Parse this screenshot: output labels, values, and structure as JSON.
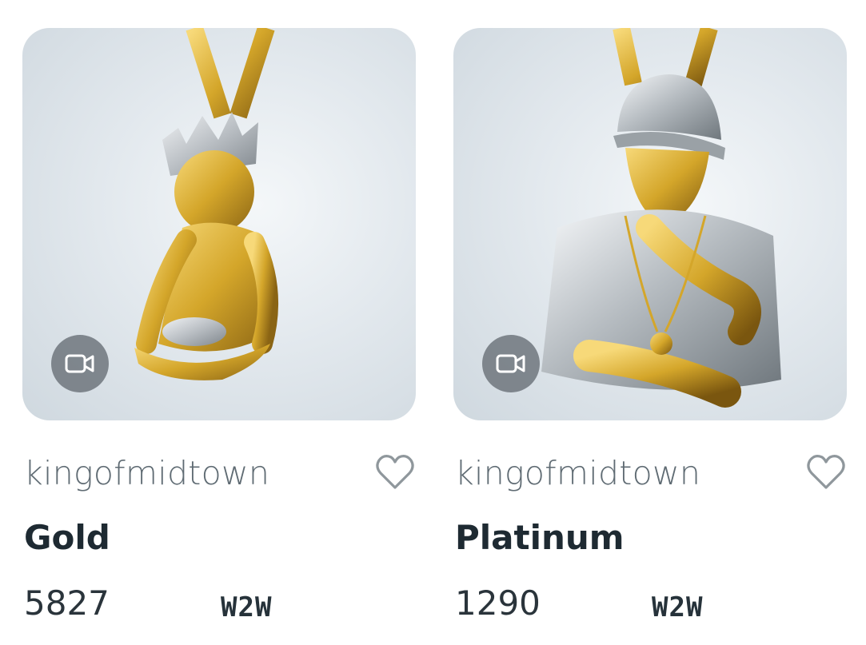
{
  "cards": [
    {
      "creator": "kingofmidtown",
      "title": "Gold",
      "number": "5827",
      "tag": "W2W",
      "media_icon": "video-camera-icon",
      "like_icon": "heart-outline-icon"
    },
    {
      "creator": "kingofmidtown",
      "title": "Platinum",
      "number": "1290",
      "tag": "W2W",
      "media_icon": "video-camera-icon",
      "like_icon": "heart-outline-icon"
    }
  ],
  "colors": {
    "gold": "#d4a62a",
    "silver": "#c3c8cc",
    "badge": "#6e767c",
    "creator_text": "#5f6b73",
    "title_text": "#1e2a32"
  }
}
